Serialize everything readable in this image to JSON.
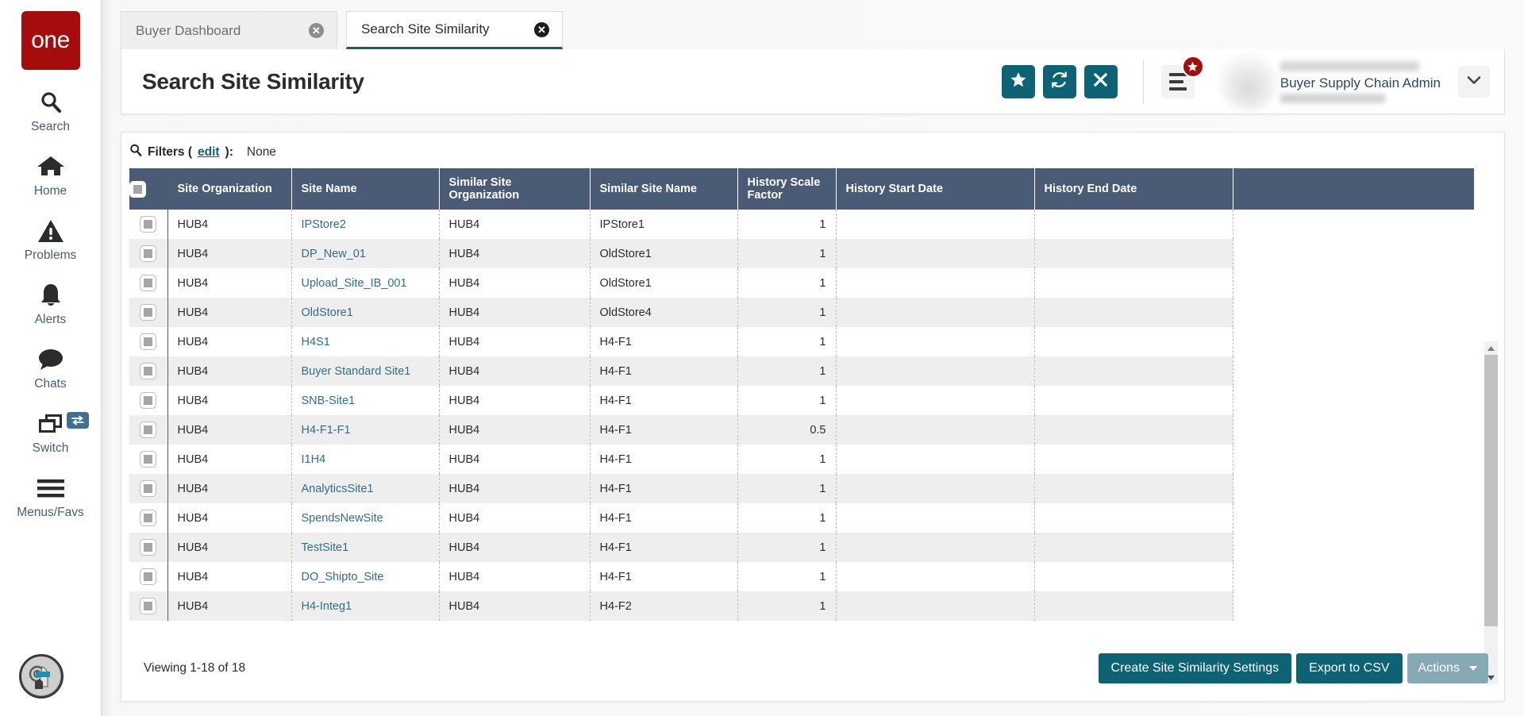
{
  "sidebar": {
    "logo_text": "one",
    "items": [
      {
        "label": "Search",
        "icon": "search-icon"
      },
      {
        "label": "Home",
        "icon": "home-icon"
      },
      {
        "label": "Problems",
        "icon": "warning-triangle-icon"
      },
      {
        "label": "Alerts",
        "icon": "bell-icon"
      },
      {
        "label": "Chats",
        "icon": "chat-bubble-icon"
      },
      {
        "label": "Switch",
        "icon": "windows-switch-icon"
      },
      {
        "label": "Menus/Favs",
        "icon": "hamburger-icon"
      }
    ],
    "bot_assistant_icon": "robot-assistant-avatar"
  },
  "tabs": [
    {
      "label": "Buyer Dashboard",
      "active": false,
      "close_glyph": "✕"
    },
    {
      "label": "Search Site Similarity",
      "active": true,
      "close_glyph": "✕"
    }
  ],
  "header": {
    "title": "Search Site Similarity",
    "actions": [
      {
        "name": "favorite-button",
        "icon": "star-icon"
      },
      {
        "name": "refresh-button",
        "icon": "refresh-icon"
      },
      {
        "name": "close-button",
        "icon": "x-icon"
      }
    ],
    "menu_button": {
      "name": "menus-favs-button",
      "icon": "hamburger-icon",
      "badge_icon": "star-icon"
    },
    "user": {
      "name_hidden": "",
      "role": "Buyer Supply Chain Admin",
      "org_hidden": ""
    },
    "caret_glyph": "❯"
  },
  "filters": {
    "icon": "search-icon",
    "label": "Filters (",
    "edit_link": "edit",
    "label_end": "):",
    "value": "None"
  },
  "table": {
    "columns": [
      "Site Organization",
      "Site Name",
      "Similar Site Organization",
      "Similar Site Name",
      "History Scale Factor",
      "History Start Date",
      "History End Date",
      ""
    ],
    "rows": [
      {
        "site_org": "HUB4",
        "site_name": "IPStore2",
        "similar_org": "HUB4",
        "similar_name": "IPStore1",
        "scale": "1",
        "start": "",
        "end": ""
      },
      {
        "site_org": "HUB4",
        "site_name": "DP_New_01",
        "similar_org": "HUB4",
        "similar_name": "OldStore1",
        "scale": "1",
        "start": "",
        "end": ""
      },
      {
        "site_org": "HUB4",
        "site_name": "Upload_Site_IB_001",
        "similar_org": "HUB4",
        "similar_name": "OldStore1",
        "scale": "1",
        "start": "",
        "end": ""
      },
      {
        "site_org": "HUB4",
        "site_name": "OldStore1",
        "similar_org": "HUB4",
        "similar_name": "OldStore4",
        "scale": "1",
        "start": "",
        "end": ""
      },
      {
        "site_org": "HUB4",
        "site_name": "H4S1",
        "similar_org": "HUB4",
        "similar_name": "H4-F1",
        "scale": "1",
        "start": "",
        "end": ""
      },
      {
        "site_org": "HUB4",
        "site_name": "Buyer Standard Site1",
        "similar_org": "HUB4",
        "similar_name": "H4-F1",
        "scale": "1",
        "start": "",
        "end": ""
      },
      {
        "site_org": "HUB4",
        "site_name": "SNB-Site1",
        "similar_org": "HUB4",
        "similar_name": "H4-F1",
        "scale": "1",
        "start": "",
        "end": ""
      },
      {
        "site_org": "HUB4",
        "site_name": "H4-F1-F1",
        "similar_org": "HUB4",
        "similar_name": "H4-F1",
        "scale": "0.5",
        "start": "",
        "end": ""
      },
      {
        "site_org": "HUB4",
        "site_name": "I1H4",
        "similar_org": "HUB4",
        "similar_name": "H4-F1",
        "scale": "1",
        "start": "",
        "end": ""
      },
      {
        "site_org": "HUB4",
        "site_name": "AnalyticsSite1",
        "similar_org": "HUB4",
        "similar_name": "H4-F1",
        "scale": "1",
        "start": "",
        "end": ""
      },
      {
        "site_org": "HUB4",
        "site_name": "SpendsNewSite",
        "similar_org": "HUB4",
        "similar_name": "H4-F1",
        "scale": "1",
        "start": "",
        "end": ""
      },
      {
        "site_org": "HUB4",
        "site_name": "TestSite1",
        "similar_org": "HUB4",
        "similar_name": "H4-F1",
        "scale": "1",
        "start": "",
        "end": ""
      },
      {
        "site_org": "HUB4",
        "site_name": "DO_Shipto_Site",
        "similar_org": "HUB4",
        "similar_name": "H4-F1",
        "scale": "1",
        "start": "",
        "end": ""
      },
      {
        "site_org": "HUB4",
        "site_name": "H4-Integ1",
        "similar_org": "HUB4",
        "similar_name": "H4-F2",
        "scale": "1",
        "start": "",
        "end": ""
      }
    ]
  },
  "footer": {
    "viewing": "Viewing 1-18 of 18",
    "create_button": "Create Site Similarity Settings",
    "export_button": "Export to CSV",
    "actions_button": "Actions"
  },
  "colors": {
    "brand_red": "#a50d0d",
    "teal": "#0d6274",
    "header_slate": "#4a5c75",
    "link": "#2f6f86",
    "muted_button": "#86aab3"
  }
}
